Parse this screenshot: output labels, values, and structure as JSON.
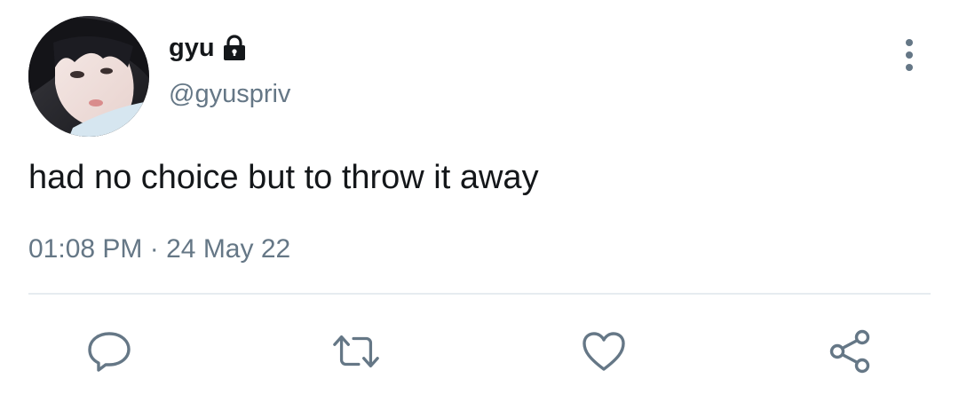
{
  "tweet": {
    "display_name": "gyu",
    "handle": "@gyuspriv",
    "text": "had no choice but to throw it away",
    "time": "01:08 PM",
    "separator": "·",
    "date": "24 May 22"
  },
  "icons": {
    "lock": "lock-icon",
    "more": "more-vertical-icon",
    "reply": "reply-icon",
    "retweet": "retweet-icon",
    "like": "heart-icon",
    "share": "share-icon"
  },
  "colors": {
    "primary_text": "#14171a",
    "secondary_text": "#657786",
    "icon": "#657786",
    "divider": "#e6ecf0"
  }
}
